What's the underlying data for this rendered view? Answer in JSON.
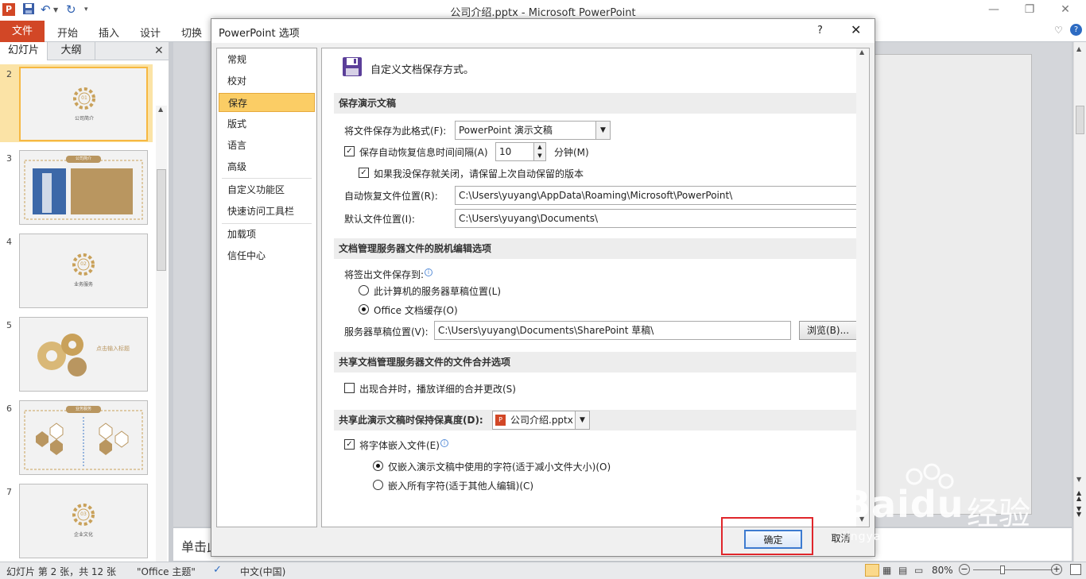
{
  "window": {
    "title": "公司介绍.pptx - Microsoft PowerPoint"
  },
  "ribbon": {
    "file_tab": "文件",
    "tabs": [
      "开始",
      "插入",
      "设计",
      "切换"
    ]
  },
  "left_panel": {
    "tabs": [
      "幻灯片",
      "大纲"
    ],
    "slides": [
      {
        "num": "2",
        "caption": "公司简介",
        "badge": "01"
      },
      {
        "num": "3",
        "caption": "公司简介"
      },
      {
        "num": "4",
        "caption": "业务服务",
        "badge": "02"
      },
      {
        "num": "5",
        "caption": "点击输入标题"
      },
      {
        "num": "6",
        "caption": "业务服务"
      },
      {
        "num": "7",
        "caption": "企业文化",
        "badge": "03"
      }
    ]
  },
  "notes": {
    "placeholder": "单击此"
  },
  "status": {
    "slide_info": "幻灯片 第 2 张，共 12 张",
    "theme": "\"Office 主题\"",
    "language": "中文(中国)",
    "zoom": "80%"
  },
  "dialog": {
    "title": "PowerPoint 选项",
    "help": "?",
    "nav": [
      "常规",
      "校对",
      "保存",
      "版式",
      "语言",
      "高级",
      "自定义功能区",
      "快速访问工具栏",
      "加载项",
      "信任中心"
    ],
    "selected_nav": "保存",
    "header_text": "自定义文档保存方式。",
    "sec_save": {
      "title": "保存演示文稿",
      "format_label": "将文件保存为此格式(F):",
      "format_value": "PowerPoint 演示文稿",
      "autorecover_label": "保存自动恢复信息时间间隔(A)",
      "autorecover_checked": true,
      "interval_value": "10",
      "minutes_label": "分钟(M)",
      "keep_label": "如果我没保存就关闭，请保留上次自动保留的版本",
      "keep_checked": true,
      "autorecover_loc_label": "自动恢复文件位置(R):",
      "autorecover_loc_value": "C:\\Users\\yuyang\\AppData\\Roaming\\Microsoft\\PowerPoint\\",
      "default_loc_label": "默认文件位置(I):",
      "default_loc_value": "C:\\Users\\yuyang\\Documents\\"
    },
    "sec_offline": {
      "title": "文档管理服务器文件的脱机编辑选项",
      "checkout_label": "将签出文件保存到:",
      "opt_server": "此计算机的服务器草稿位置(L)",
      "opt_cache": "Office 文档缓存(O)",
      "selected": "Office 文档缓存(O)",
      "drafts_label": "服务器草稿位置(V):",
      "drafts_value": "C:\\Users\\yuyang\\Documents\\SharePoint 草稿\\",
      "browse_label": "浏览(B)..."
    },
    "sec_merge": {
      "title": "共享文档管理服务器文件的文件合并选项",
      "merge_label": "出现合并时，播放详细的合并更改(S)",
      "merge_checked": false
    },
    "sec_fidelity": {
      "title": "共享此演示文稿时保持保真度(D):",
      "file_value": "公司介绍.pptx",
      "embed_label": "将字体嵌入文件(E)",
      "embed_checked": true,
      "opt_used": "仅嵌入演示文稿中使用的字符(适于减小文件大小)(O)",
      "opt_all": "嵌入所有字符(适于其他人编辑)(C)",
      "selected": "仅嵌入演示文稿中使用的字符(适于减小文件大小)(O)"
    },
    "ok_label": "确定",
    "cancel_label": "取消"
  },
  "watermark": {
    "brand": "Bai",
    "brand2": "du",
    "cn": "经验",
    "url": "jingyan.baidu.com"
  },
  "colors": {
    "accent_file": "#d24726",
    "nav_selected": "#fbcd65",
    "highlight_box": "#e0262b",
    "thumb_selected": "#f6b842"
  }
}
